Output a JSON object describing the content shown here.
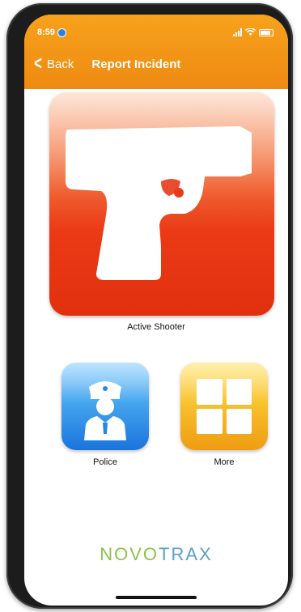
{
  "status_bar": {
    "time": "8:59",
    "icons": [
      "location-icon",
      "signal-icon",
      "wifi-icon",
      "battery-icon"
    ]
  },
  "nav": {
    "back_label": "Back",
    "title": "Report Incident"
  },
  "tiles": {
    "main": {
      "label": "Active Shooter",
      "icon": "handgun-icon"
    },
    "police": {
      "label": "Police",
      "icon": "police-officer-icon"
    },
    "more": {
      "label": "More",
      "icon": "grid-icon"
    }
  },
  "logo": {
    "part1": "NOVO",
    "part2": "TRAX"
  },
  "colors": {
    "header": "#f39317",
    "main_tile": "#e8391a",
    "police_tile": "#2a86e3",
    "more_tile": "#f5b422",
    "logo_green": "#8bc34a",
    "logo_blue": "#5aa0c8"
  }
}
